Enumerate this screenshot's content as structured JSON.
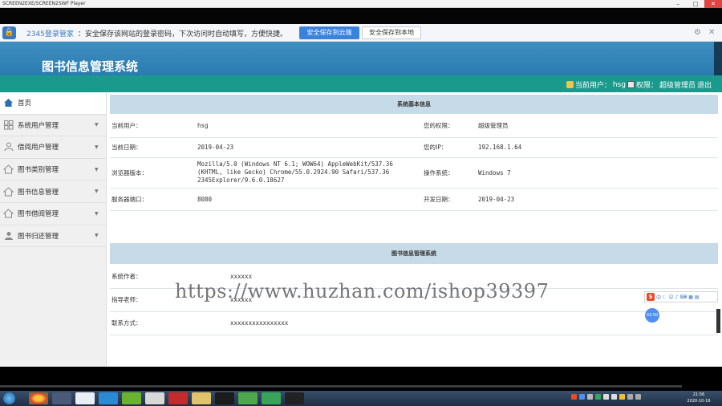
{
  "window": {
    "title": "SCREEN2EXE/SCREEN2SWF Player"
  },
  "password_bar": {
    "brand": "2345登录管家",
    "message": "：安全保存该网站的登录密码，下次访问时自动填写，方便快捷。",
    "save_cloud": "安全保存到云端",
    "save_local": "安全保存到本地"
  },
  "header": {
    "title": "图书信息管理系统"
  },
  "userbar": {
    "current_user_label": "当前用户：",
    "current_user": "hsg",
    "role_label": "权限：",
    "role": "超级管理员",
    "logout": "退出"
  },
  "sidebar": {
    "items": [
      {
        "label": "首页",
        "icon": "home-icon"
      },
      {
        "label": "系统用户管理",
        "icon": "grid-icon"
      },
      {
        "label": "借阅用户管理",
        "icon": "user-icon"
      },
      {
        "label": "图书类别管理",
        "icon": "house-icon"
      },
      {
        "label": "图书信息管理",
        "icon": "house-icon"
      },
      {
        "label": "图书借阅管理",
        "icon": "house-icon"
      },
      {
        "label": "图书归还管理",
        "icon": "user-icon"
      }
    ]
  },
  "system_info": {
    "heading": "系统基本信息",
    "rows": [
      {
        "l1": "当前用户：",
        "v1": "hsg",
        "l2": "您的权限：",
        "v2": "超级管理员"
      },
      {
        "l1": "当前日期：",
        "v1": "2019-04-23",
        "l2": "您的IP：",
        "v2": "192.168.1.64"
      },
      {
        "l1": "浏览器版本：",
        "v1": "Mozilla/5.0 (Windows NT 6.1; WOW64) AppleWebKit/537.36 (KHTML, like Gecko) Chrome/55.0.2924.90 Safari/537.36 2345Explorer/9.6.0.18627",
        "l2": "操作系统：",
        "v2": "Windows 7"
      },
      {
        "l1": "服务器端口：",
        "v1": "8080",
        "l2": "开发日期：",
        "v2": "2019-04-23"
      }
    ]
  },
  "about": {
    "heading": "图书信息管理系统",
    "rows": [
      {
        "label": "系统作者：",
        "value": "xxxxxx"
      },
      {
        "label": "指导老师：",
        "value": "xxxxxx"
      },
      {
        "label": "联系方式：",
        "value": "xxxxxxxxxxxxxxxx"
      }
    ]
  },
  "overlay": {
    "watermark": "https://www.huzhan.com/ishop39397",
    "ime_logo": "S",
    "ime_label": "中",
    "badge": "02:50"
  },
  "taskbar": {
    "time": "21:56",
    "date": "2020-10-16"
  },
  "colors": {
    "header_blue": "#2e84b8",
    "userbar_teal": "#1a9a8c",
    "section_head": "#c6dbe7",
    "save_cloud_blue": "#3a83dd"
  }
}
